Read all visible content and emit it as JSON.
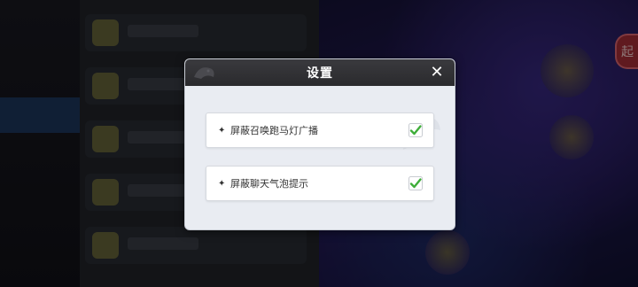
{
  "dialog": {
    "title": "设置",
    "close_glyph": "✕"
  },
  "options": [
    {
      "bullet": "✦",
      "label": "屏蔽召唤跑马灯广播",
      "checked": true
    },
    {
      "bullet": "✦",
      "label": "屏蔽聊天气泡提示",
      "checked": true
    }
  ],
  "side_badge": "起",
  "colors": {
    "header_bg": "#2d2d30",
    "dialog_bg": "#e9ecf2",
    "check_green": "#3fae3a"
  },
  "icons": {
    "close": "close-icon",
    "check": "checkmark-icon"
  }
}
